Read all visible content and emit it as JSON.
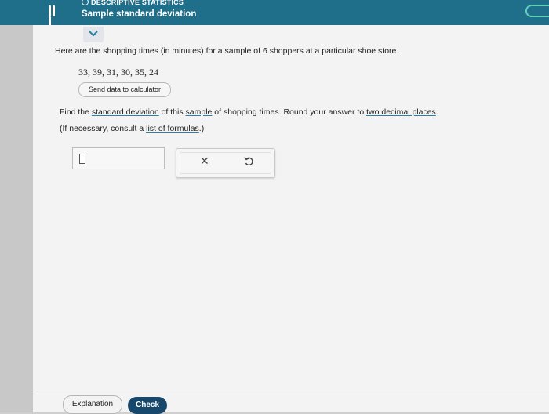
{
  "header": {
    "topic": "DESCRIPTIVE STATISTICS",
    "title": "Sample standard deviation"
  },
  "problem": {
    "intro": "Here are the shopping times (in minutes) for a sample of 6 shoppers at a particular shoe store.",
    "values": "33, 39, 31, 30, 35, 24",
    "send_button": "Send data to calculator",
    "question_prefix": "Find the ",
    "question_link1": "standard deviation",
    "question_mid": " of this ",
    "question_link2": "sample",
    "question_mid2": " of shopping times. Round your answer to ",
    "question_link3": "two decimal places",
    "question_suffix": ".",
    "hint_prefix": "(If necessary, consult a ",
    "hint_link": "list of formulas",
    "hint_suffix": ".)"
  },
  "answer": {
    "value": ""
  },
  "tools": {
    "clear_icon": "x-icon",
    "undo_icon": "undo-icon"
  },
  "footer": {
    "explanation": "Explanation",
    "check": "Check"
  },
  "colors": {
    "header": "#1f6f8b",
    "check_button": "#17486b",
    "accent_pill": "#5ed2b8"
  }
}
